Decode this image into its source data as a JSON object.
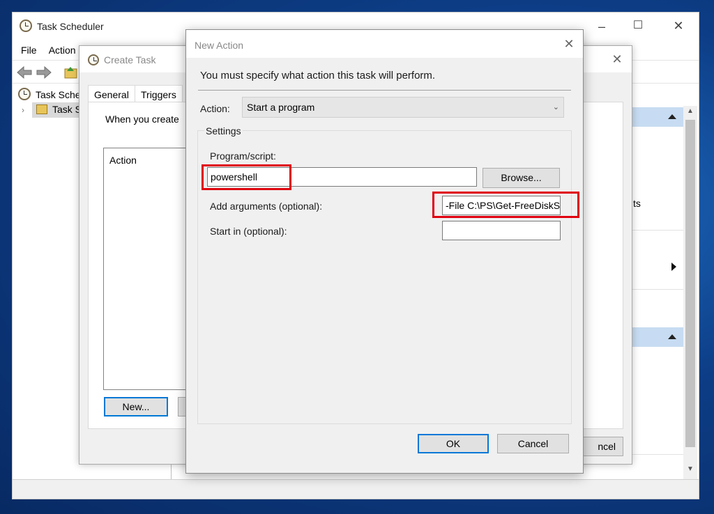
{
  "task_scheduler": {
    "title": "Task Scheduler",
    "menu": [
      "File",
      "Action"
    ],
    "tree": [
      {
        "label": "Task Sche"
      },
      {
        "label": "Task S"
      }
    ]
  },
  "create_task": {
    "title": "Create Task",
    "tabs": [
      "General",
      "Triggers"
    ],
    "intro_text": "When you create",
    "list_header": "Action",
    "new_button": "New...",
    "cancel_partial": "ncel"
  },
  "new_action": {
    "title": "New Action",
    "instruction": "You must specify what action this task will perform.",
    "action_label": "Action:",
    "action_value": "Start a program",
    "settings_label": "Settings",
    "program_label": "Program/script:",
    "program_value": "powershell",
    "browse_button": "Browse...",
    "arguments_label": "Add arguments (optional):",
    "arguments_value": "-File C:\\PS\\Get-FreeDiskS",
    "start_in_label": "Start in (optional):",
    "start_in_value": "",
    "ok_button": "OK",
    "cancel_button": "Cancel"
  },
  "right_pane": {
    "partial_text": "ts"
  },
  "colors": {
    "highlight": "#e0000f",
    "focus": "#0078d7",
    "pane_header": "#c7dcf2"
  }
}
